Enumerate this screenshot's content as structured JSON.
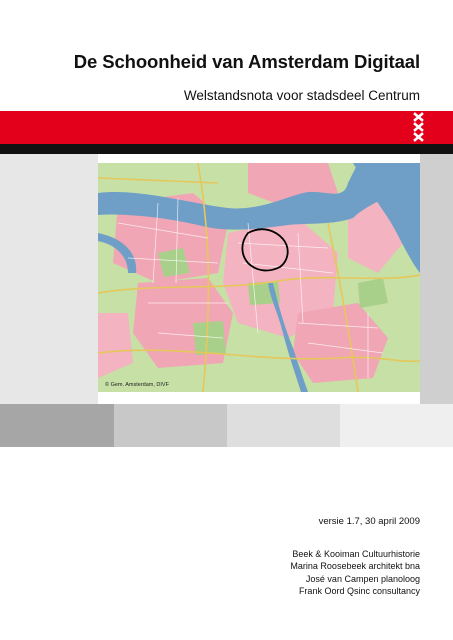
{
  "title": "De Schoonheid van Amsterdam Digitaal",
  "subtitle": "Welstandsnota voor stadsdeel Centrum",
  "map": {
    "credit": "© Gem. Amsterdam, DIVF"
  },
  "version": "versie 1.7, 30 april 2009",
  "credits": [
    "Beek & Kooiman Cultuurhistorie",
    "Marina Roosebeek architekt bna",
    "José van Campen planoloog",
    "Frank Oord Qsinc consultancy"
  ],
  "colors": {
    "amsterdam_red": "#e3001b",
    "band_black": "#111111",
    "map_water": "#6f9fc6",
    "map_urban": "#f1a6b5",
    "map_green": "#b9d99a",
    "map_outline": "#000000"
  },
  "icons": [
    "andreas-cross-icon",
    "andreas-cross-icon",
    "andreas-cross-icon"
  ]
}
